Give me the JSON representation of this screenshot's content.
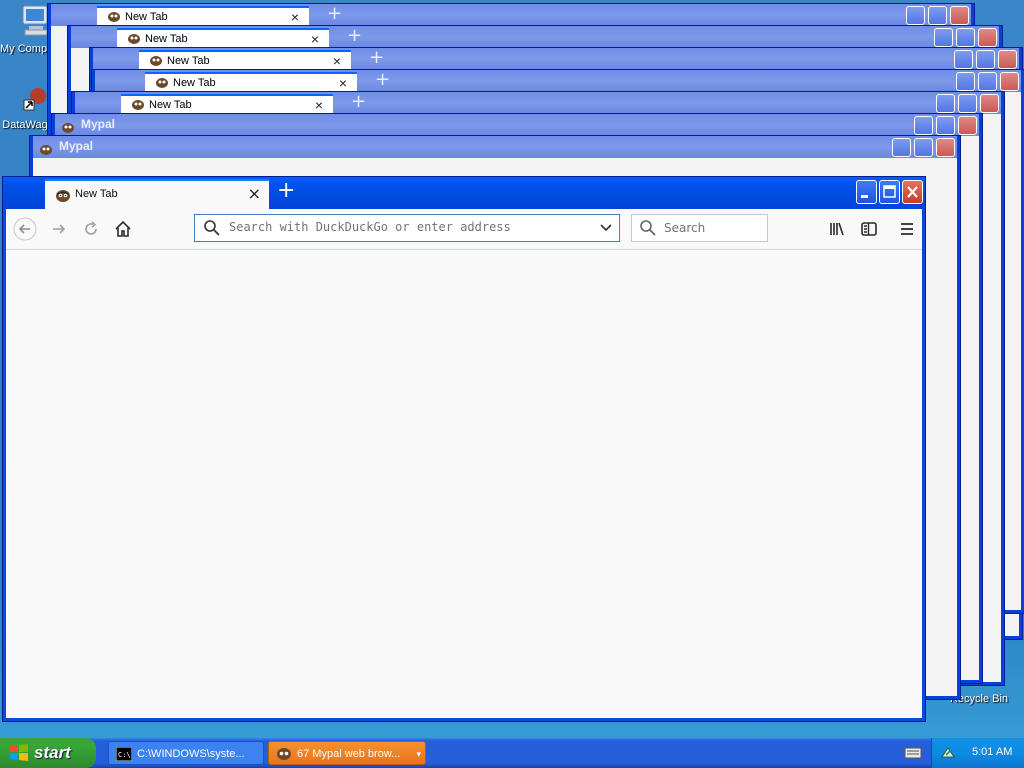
{
  "desktop": {
    "icons": [
      {
        "label": "My Computer",
        "icon": "my-computer-icon"
      },
      {
        "label": "DataWag",
        "icon": "shortcut-icon"
      },
      {
        "label": "Recycle Bin",
        "icon": "recycle-bin-icon"
      }
    ]
  },
  "background_windows": [
    {
      "tab": "New Tab"
    },
    {
      "tab": "New Tab"
    },
    {
      "tab": "New Tab"
    },
    {
      "tab": "New Tab"
    },
    {
      "tab": "New Tab"
    },
    {
      "title": "Mypal"
    },
    {
      "title": "Mypal"
    }
  ],
  "browser": {
    "tab_label": "New Tab",
    "tab_close": "×",
    "new_tab": "+",
    "url_placeholder": "Search with DuckDuckGo or enter address",
    "search_placeholder": "Search",
    "buttons": {
      "back": "back-arrow-icon",
      "forward": "forward-arrow-icon",
      "reload": "reload-icon",
      "home": "home-icon",
      "library": "library-icon",
      "sidebar": "sidebar-icon",
      "menu": "hamburger-menu-icon"
    }
  },
  "taskbar": {
    "start_label": "start",
    "tasks": [
      {
        "label": "C:\\WINDOWS\\syste...",
        "icon": "cmd-icon",
        "active": false
      },
      {
        "label": "67 Mypal web brow...",
        "icon": "mypal-icon",
        "active": true
      }
    ],
    "clock": "5:01 AM"
  },
  "colors": {
    "xp_blue": "#0a48e0",
    "start_green": "#37a839",
    "active_task_orange": "#f07c18",
    "close_red": "#c83e24"
  }
}
